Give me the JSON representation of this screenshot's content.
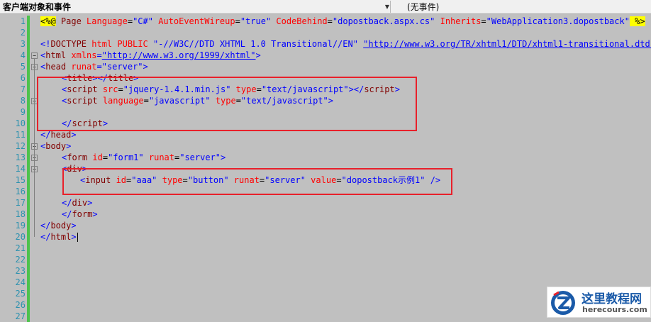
{
  "toolbar": {
    "left_dropdown": "客户端对象和事件",
    "right_dropdown": "(无事件)"
  },
  "line_numbers": [
    "1",
    "2",
    "3",
    "4",
    "5",
    "6",
    "7",
    "8",
    "9",
    "10",
    "11",
    "12",
    "13",
    "14",
    "15",
    "16",
    "17",
    "18",
    "19",
    "20",
    "21",
    "22",
    "23",
    "24",
    "25",
    "26",
    "27"
  ],
  "code": {
    "l1": {
      "open": "<%@",
      "page": " Page ",
      "a1": "Language",
      "v1": "\"C#\"",
      "a2": " AutoEventWireup",
      "v2": "\"true\"",
      "a3": " CodeBehind",
      "v3": "\"dopostback.aspx.cs\"",
      "a4": " Inherits",
      "v4": "\"WebApplication3.dopostback\"",
      "close": " %>"
    },
    "l3": {
      "open": "<!",
      "doctype": "DOCTYPE",
      "html": " html",
      "public": " PUBLIC",
      "dtd": " \"-//W3C//DTD XHTML 1.0 Transitional//EN\" ",
      "url": "\"http://www.w3.org/TR/xhtml1/DTD/xhtml1-transitional.dtd\"",
      "close": ">"
    },
    "l4": {
      "lt": "<",
      "tag": "html",
      "attr": " xmlns",
      "eq": "=",
      "val": "\"http://www.w3.org/1999/xhtml\"",
      "gt": ">"
    },
    "l5": {
      "lt": "<",
      "tag": "head",
      "attr": " runat",
      "eq": "=",
      "val": "\"server\"",
      "gt": ">"
    },
    "l6": {
      "lt": "<",
      "tag": "title",
      "mid": "></",
      "tag2": "title",
      "gt": ">"
    },
    "l7": {
      "lt": "<",
      "tag": "script",
      "a1": " src",
      "v1": "\"jquery-1.4.1.min.js\"",
      "a2": " type",
      "v2": "\"text/javascript\"",
      "mid": "></",
      "tag2": "script",
      "gt": ">"
    },
    "l8": {
      "lt": "<",
      "tag": "script",
      "a1": " language",
      "v1": "\"javascript\"",
      "a2": " type",
      "v2": "\"text/javascript\"",
      "gt": ">"
    },
    "l10": {
      "lt": "</",
      "tag": "script",
      "gt": ">"
    },
    "l11": {
      "lt": "</",
      "tag": "head",
      "gt": ">"
    },
    "l12": {
      "lt": "<",
      "tag": "body",
      "gt": ">"
    },
    "l13": {
      "lt": "<",
      "tag": "form",
      "a1": " id",
      "v1": "\"form1\"",
      "a2": " runat",
      "v2": "\"server\"",
      "gt": ">"
    },
    "l14": {
      "lt": "<",
      "tag": "div",
      "gt": ">"
    },
    "l15": {
      "lt": "<",
      "tag": "input",
      "a1": " id",
      "v1": "\"aaa\"",
      "a2": " type",
      "v2": "\"button\"",
      "a3": " runat",
      "v3": "\"server\"",
      "a4": " value",
      "v4": "\"dopostback示例1\"",
      "gt": " />"
    },
    "l17": {
      "lt": "</",
      "tag": "div",
      "gt": ">"
    },
    "l18": {
      "lt": "</",
      "tag": "form",
      "gt": ">"
    },
    "l19": {
      "lt": "</",
      "tag": "body",
      "gt": ">"
    },
    "l20": {
      "lt": "</",
      "tag": "html",
      "gt": ">"
    }
  },
  "watermark": {
    "title": "这里教程网",
    "domain": "herecours.com"
  },
  "colors": {
    "tag": "#800000",
    "attr": "#ff0000",
    "value": "#0000ff",
    "highlight": "#ff0000",
    "changebar": "#4cc24c",
    "background": "#c0c0c0"
  },
  "icons": [
    "chevron-down-icon",
    "fold-toggle-icon",
    "site-logo-icon"
  ]
}
